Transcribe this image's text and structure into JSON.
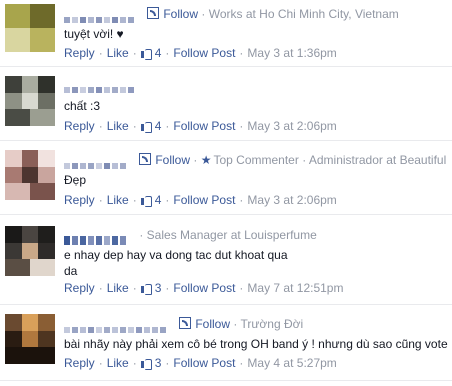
{
  "comments": [
    {
      "meta": {
        "follow": "Follow",
        "extra": "· Works at Ho Chi Minh City, Vietnam"
      },
      "text": "tuyệt vời! ♥",
      "actions": {
        "reply": "Reply",
        "like": "Like",
        "likes": "4",
        "follow_post": "Follow Post",
        "time": "May 3 at 1:36pm"
      }
    },
    {
      "meta": {},
      "text": "chất :3",
      "actions": {
        "reply": "Reply",
        "like": "Like",
        "likes": "4",
        "follow_post": "Follow Post",
        "time": "May 3 at 2:06pm"
      }
    },
    {
      "meta": {
        "follow": "Follow",
        "top_commenter": "Top Commenter",
        "extra": "· Administrador at Beautiful"
      },
      "text": "Đẹp",
      "actions": {
        "reply": "Reply",
        "like": "Like",
        "likes": "4",
        "follow_post": "Follow Post",
        "time": "May 3 at 2:06pm"
      }
    },
    {
      "meta": {
        "extra": "· Sales Manager at Louisperfume"
      },
      "text": "e nhay dep hay va dong tac dut khoat qua da",
      "actions": {
        "reply": "Reply",
        "like": "Like",
        "likes": "3",
        "follow_post": "Follow Post",
        "time": "May 7 at 12:51pm"
      }
    },
    {
      "meta": {
        "follow": "Follow",
        "extra": "· Trường Đời"
      },
      "text": "bài nhãy này phải xem cô bé trong OH band ý ! nhưng dù sao cũng vote",
      "actions": {
        "reply": "Reply",
        "like": "Like",
        "likes": "3",
        "follow_post": "Follow Post",
        "time": "May 4 at 5:27pm"
      }
    }
  ],
  "colors": {
    "link": "#3b5998",
    "muted": "#9197a3",
    "divider": "#e9eaed"
  }
}
